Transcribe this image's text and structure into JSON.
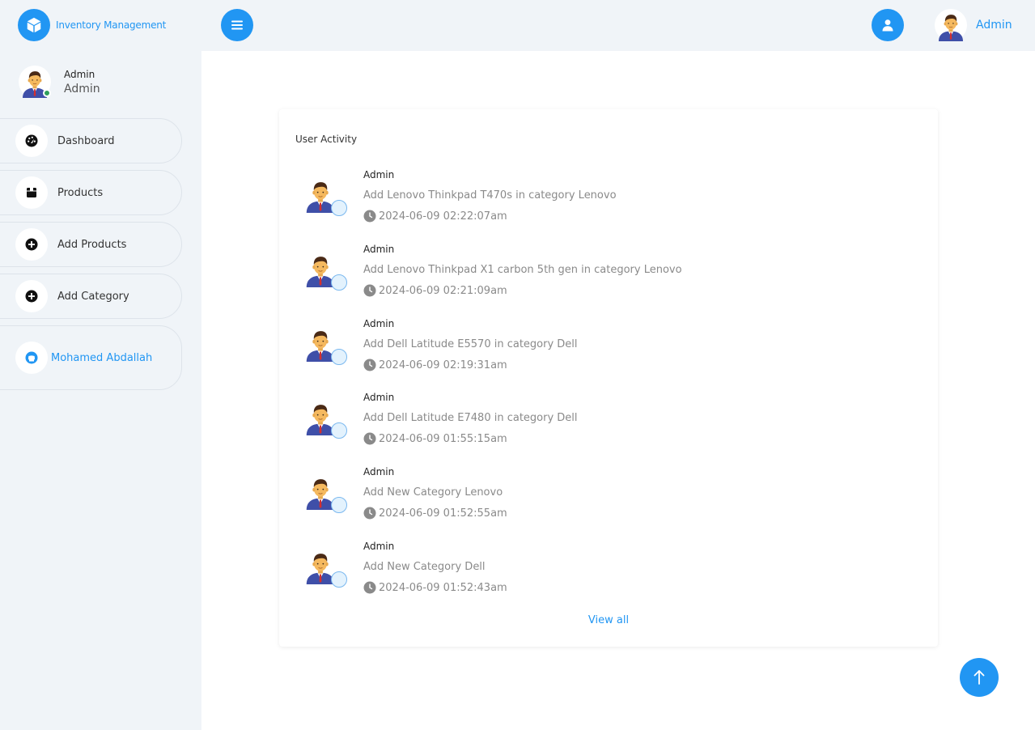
{
  "header": {
    "brand_name": "Inventory Management",
    "brand_icon": "box-icon",
    "menu_icon": "hamburger-icon",
    "user_icon": "user-icon",
    "profile_name": "Admin"
  },
  "sidebar": {
    "user": {
      "name": "Admin",
      "role": "Admin",
      "status": "online"
    },
    "items": [
      {
        "label": "Dashboard",
        "icon": "gauge-icon"
      },
      {
        "label": "Products",
        "icon": "box-icon"
      },
      {
        "label": "Add Products",
        "icon": "plus-circle-icon"
      },
      {
        "label": "Add Category",
        "icon": "plus-circle-icon"
      }
    ],
    "github": {
      "label": "Mohamed Abdallah",
      "icon": "github-icon"
    }
  },
  "main": {
    "card_title": "User Activity",
    "activities": [
      {
        "user": "Admin",
        "description": "Add Lenovo Thinkpad T470s in category Lenovo",
        "time": "2024-06-09 02:22:07am"
      },
      {
        "user": "Admin",
        "description": "Add Lenovo Thinkpad X1 carbon 5th gen in category Lenovo",
        "time": "2024-06-09 02:21:09am"
      },
      {
        "user": "Admin",
        "description": "Add Dell Latitude E5570 in category Dell",
        "time": "2024-06-09 02:19:31am"
      },
      {
        "user": "Admin",
        "description": "Add Dell Latitude E7480 in category Dell",
        "time": "2024-06-09 01:55:15am"
      },
      {
        "user": "Admin",
        "description": "Add New Category Lenovo",
        "time": "2024-06-09 01:52:55am"
      },
      {
        "user": "Admin",
        "description": "Add New Category Dell",
        "time": "2024-06-09 01:52:43am"
      }
    ],
    "view_all_label": "View all"
  },
  "scroll_top_icon": "arrow-up-icon",
  "colors": {
    "accent": "#2196f3",
    "sidebar_bg": "#f0f4f8",
    "online": "#2e9e5b"
  }
}
